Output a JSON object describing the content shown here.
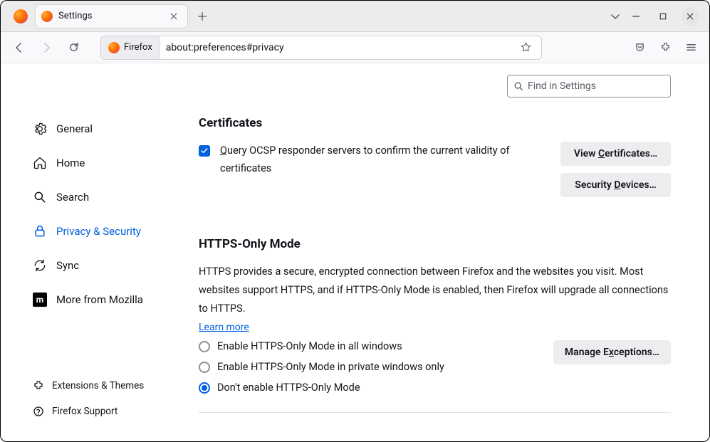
{
  "tab": {
    "title": "Settings"
  },
  "urlbar": {
    "identity": "Firefox",
    "url": "about:preferences#privacy"
  },
  "search": {
    "placeholder": "Find in Settings"
  },
  "sidebar": {
    "items": [
      {
        "label": "General"
      },
      {
        "label": "Home"
      },
      {
        "label": "Search"
      },
      {
        "label": "Privacy & Security"
      },
      {
        "label": "Sync"
      },
      {
        "label": "More from Mozilla"
      }
    ],
    "bottom": [
      {
        "label": "Extensions & Themes"
      },
      {
        "label": "Firefox Support"
      }
    ]
  },
  "certificates": {
    "heading": "Certificates",
    "ocsp_prefix": "Q",
    "ocsp_rest": "uery OCSP responder servers to confirm the current validity of certificates",
    "view_btn_pre": "View ",
    "view_btn_u": "C",
    "view_btn_post": "ertificates…",
    "devices_btn_pre": "Security ",
    "devices_btn_u": "D",
    "devices_btn_post": "evices…"
  },
  "https": {
    "heading": "HTTPS-Only Mode",
    "desc": "HTTPS provides a secure, encrypted connection between Firefox and the websites you visit. Most websites support HTTPS, and if HTTPS-Only Mode is enabled, then Firefox will upgrade all connections to HTTPS.",
    "learn": "Learn more",
    "radios": [
      "Enable HTTPS-Only Mode in all windows",
      "Enable HTTPS-Only Mode in private windows only",
      "Don't enable HTTPS-Only Mode"
    ],
    "exceptions_pre": "Manage E",
    "exceptions_u": "x",
    "exceptions_post": "ceptions…"
  }
}
